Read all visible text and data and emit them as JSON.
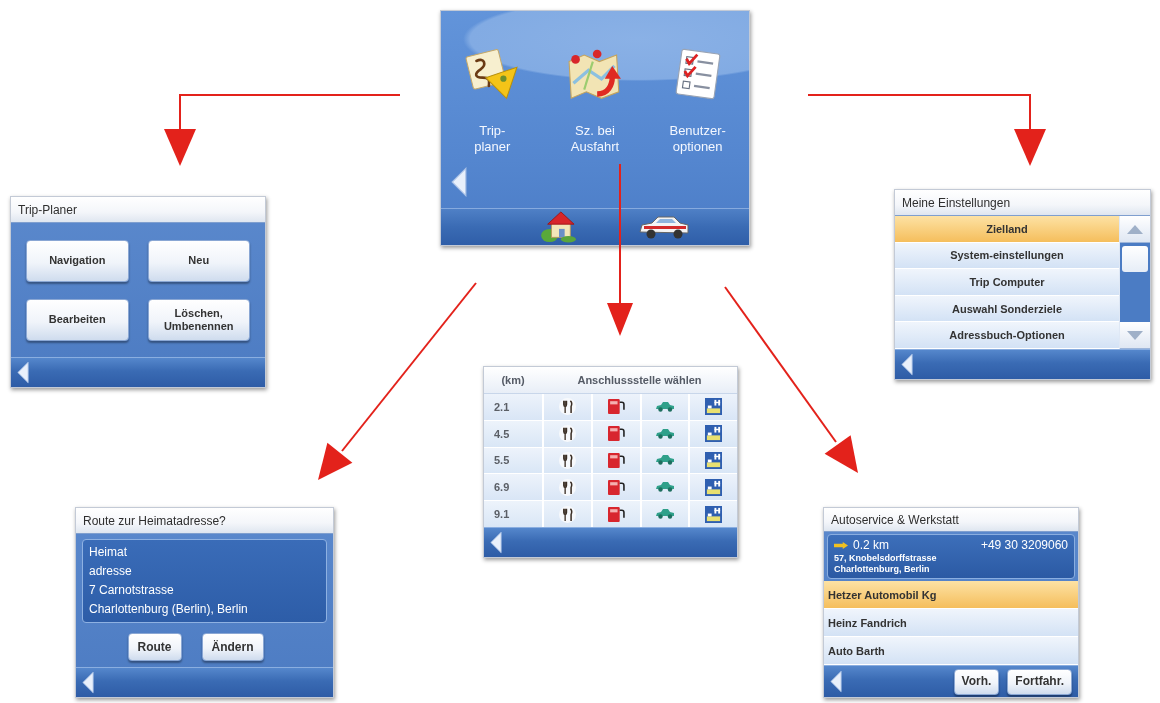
{
  "main_menu": {
    "items": [
      {
        "label": "Trip-\nplaner"
      },
      {
        "label": "Sz. bei\nAusfahrt"
      },
      {
        "label": "Benutzer-\noptionen"
      }
    ]
  },
  "trip_planer": {
    "title": "Trip-Planer",
    "buttons": [
      "Navigation",
      "Neu",
      "Bearbeiten",
      "Löschen,\nUmbenennen"
    ]
  },
  "settings": {
    "title": "Meine Einstellungen",
    "items": [
      {
        "label": "Zielland",
        "selected": true
      },
      {
        "label": "System-einstellungen",
        "selected": false
      },
      {
        "label": "Trip Computer",
        "selected": false
      },
      {
        "label": "Auswahl Sonderziele",
        "selected": false
      },
      {
        "label": "Adressbuch-Optionen",
        "selected": false
      }
    ]
  },
  "exit_list": {
    "columns": [
      "(km)",
      "Anschlussstelle wählen"
    ],
    "rows": [
      {
        "distance": "2.1"
      },
      {
        "distance": "4.5"
      },
      {
        "distance": "5.5"
      },
      {
        "distance": "6.9"
      },
      {
        "distance": "9.1"
      }
    ]
  },
  "home_route": {
    "title": "Route zur Heimatadresse?",
    "address_lines": [
      "Heimat",
      "adresse",
      "7 Carnotstrasse",
      "Charlottenburg (Berlin), Berlin"
    ],
    "buttons": [
      "Route",
      "Ändern"
    ]
  },
  "autoservice": {
    "title": "Autoservice & Werkstatt",
    "detail": {
      "distance": "0.2 km",
      "phone": "+49 30 3209060",
      "street": "57, Knobelsdorffstrasse",
      "city": "Charlottenburg, Berlin"
    },
    "items": [
      {
        "label": "Hetzer Automobil Kg",
        "selected": true
      },
      {
        "label": "Heinz Fandrich",
        "selected": false
      },
      {
        "label": "Auto Barth",
        "selected": false
      }
    ],
    "buttons": [
      "Vorh.",
      "Fortfahr."
    ]
  }
}
